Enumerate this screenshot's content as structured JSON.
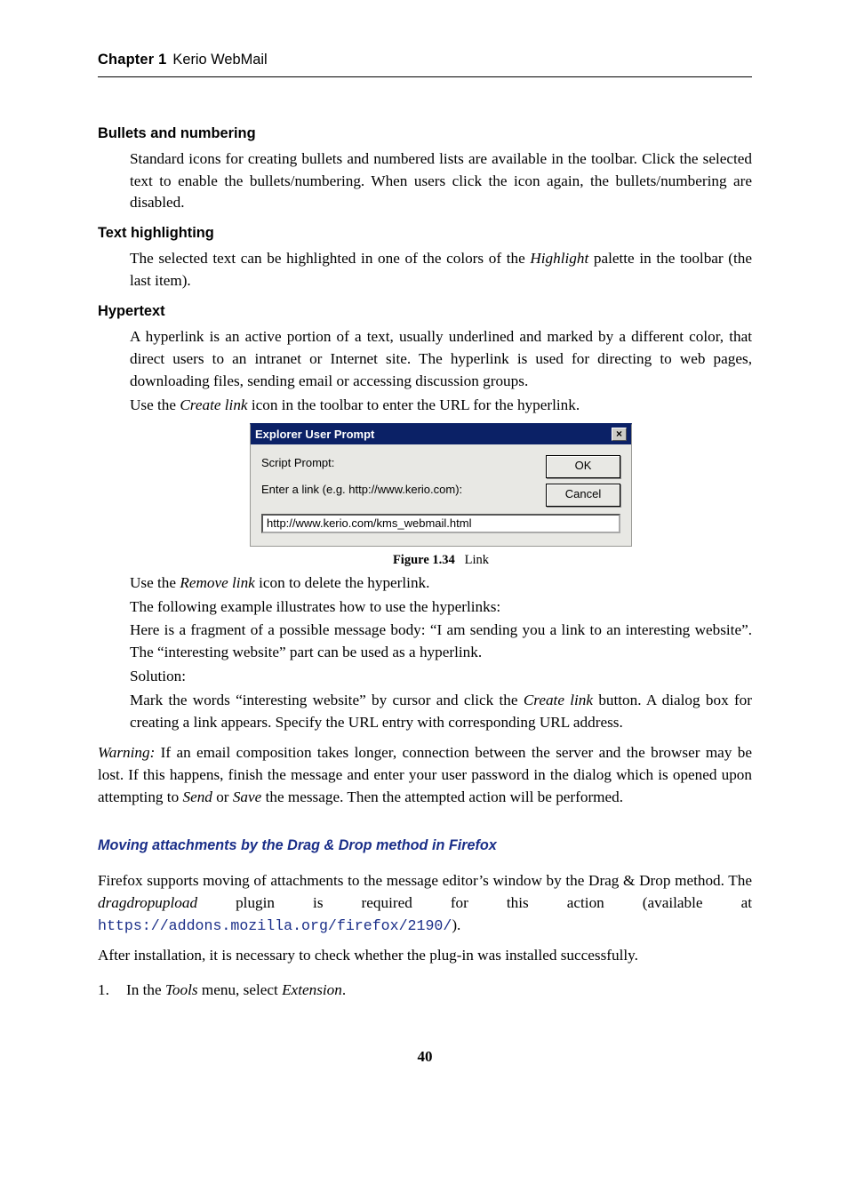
{
  "header": {
    "chapter": "Chapter 1",
    "title": "Kerio WebMail"
  },
  "sections": {
    "bullets": {
      "term": "Bullets and numbering",
      "body": "Standard icons for creating bullets and numbered lists are available in the toolbar. Click the selected text to enable the bullets/numbering. When users click the icon again, the bullets/numbering are disabled."
    },
    "highlight": {
      "term": "Text highlighting",
      "body_pre": "The selected text can be highlighted in one of the colors of the ",
      "body_em": "Highlight",
      "body_post": " palette in the toolbar (the last item)."
    },
    "hypertext": {
      "term": "Hypertext",
      "p1": "A hyperlink is an active portion of a text, usually underlined and marked by a different color, that direct users to an intranet or Internet site. The hyperlink is used for directing to web pages, downloading files, sending email or accessing discussion groups.",
      "p2_pre": "Use the ",
      "p2_em": "Create link",
      "p2_post": " icon in the toolbar to enter the URL for the hyperlink.",
      "dialog": {
        "title": "Explorer User Prompt",
        "close": "×",
        "script_prompt": "Script Prompt:",
        "enter_link": "Enter a link (e.g. http://www.kerio.com):",
        "ok": "OK",
        "cancel": "Cancel",
        "value": "http://www.kerio.com/kms_webmail.html"
      },
      "figcap_b": "Figure 1.34",
      "figcap_r": "Link",
      "p3_pre": "Use the ",
      "p3_em": "Remove link",
      "p3_post": " icon to delete the hyperlink.",
      "p4": "The following example illustrates how to use the hyperlinks:",
      "p5": "Here is a fragment of a possible message body: “I am sending you a link to an interesting website”. The “interesting website” part can be used as a hyperlink.",
      "p6": "Solution:",
      "p7_pre": "Mark the words “interesting website” by cursor and click the ",
      "p7_em": "Create link",
      "p7_post": " button. A dialog box for creating a link appears. Specify the URL entry with corresponding URL address."
    }
  },
  "warning": {
    "em1": "Warning:",
    "body1": " If an email composition takes longer, connection between the server and the browser may be lost. If this happens, finish the message and enter your user password in the dialog which is opened upon attempting to ",
    "em2": "Send",
    "mid": " or ",
    "em3": "Save",
    "body2": " the message. Then the attempted action will be performed."
  },
  "firefox": {
    "heading": "Moving attachments by the Drag & Drop method in Firefox",
    "p1_a": "Firefox supports moving of attachments to the message editor’s window by the Drag & Drop method.   The ",
    "p1_em": "dragdropupload",
    "p1_b": " plugin is required for this action (available at ",
    "link": "https://addons.mozilla.org/firefox/2190/",
    "p1_c": ").",
    "p2": "After installation, it is necessary to check whether the plug-in was installed successfully.",
    "li_num": "1.",
    "li_a": "In the ",
    "li_em1": "Tools",
    "li_b": " menu, select ",
    "li_em2": "Extension",
    "li_c": "."
  },
  "page": "40"
}
